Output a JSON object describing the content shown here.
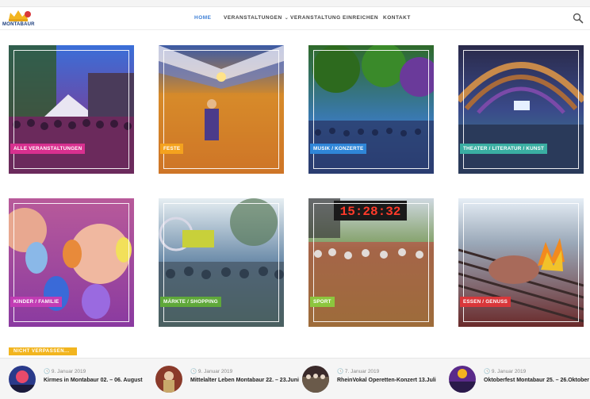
{
  "brand": {
    "logo_text": "MONTABAUR"
  },
  "nav": {
    "items": [
      {
        "label": "HOME",
        "active": true
      },
      {
        "label": "VERANSTALTUNGEN",
        "caret": true
      },
      {
        "label": "VERANSTALTUNG EINREICHEN"
      },
      {
        "label": "KONTAKT"
      }
    ],
    "search_icon": "search-icon"
  },
  "categories": [
    {
      "label": "ALLE VERANSTALTUNGEN",
      "color": "#d8308f"
    },
    {
      "label": "FESTE",
      "color": "#f4a21e"
    },
    {
      "label": "MUSIK / KONZERTE",
      "color": "#2f86d8"
    },
    {
      "label": "THEATER / LITERATUR / KUNST",
      "color": "#3aaea2"
    },
    {
      "label": "KINDER / FAMILIE",
      "color": "#c23cb4"
    },
    {
      "label": "MÄRKTE / SHOPPING",
      "color": "#5fa83a"
    },
    {
      "label": "SPORT",
      "color": "#8cc63e"
    },
    {
      "label": "ESSEN / GENUSS",
      "color": "#d9373a"
    }
  ],
  "kicker": "NICHT VERPASSEN...",
  "events": [
    {
      "date": "9. Januar 2019",
      "title": "Kirmes in Montabaur 02. – 06. August"
    },
    {
      "date": "9. Januar 2019",
      "title": "Mittelalter Leben Montabaur 22. – 23.Juni"
    },
    {
      "date": "7. Januar 2019",
      "title": "RheinVokal Operetten-Konzert 13.Juli"
    },
    {
      "date": "9. Januar 2019",
      "title": "Oktoberfest Montabaur 25. – 26.Oktober"
    }
  ],
  "clock_display": "15:28:32"
}
